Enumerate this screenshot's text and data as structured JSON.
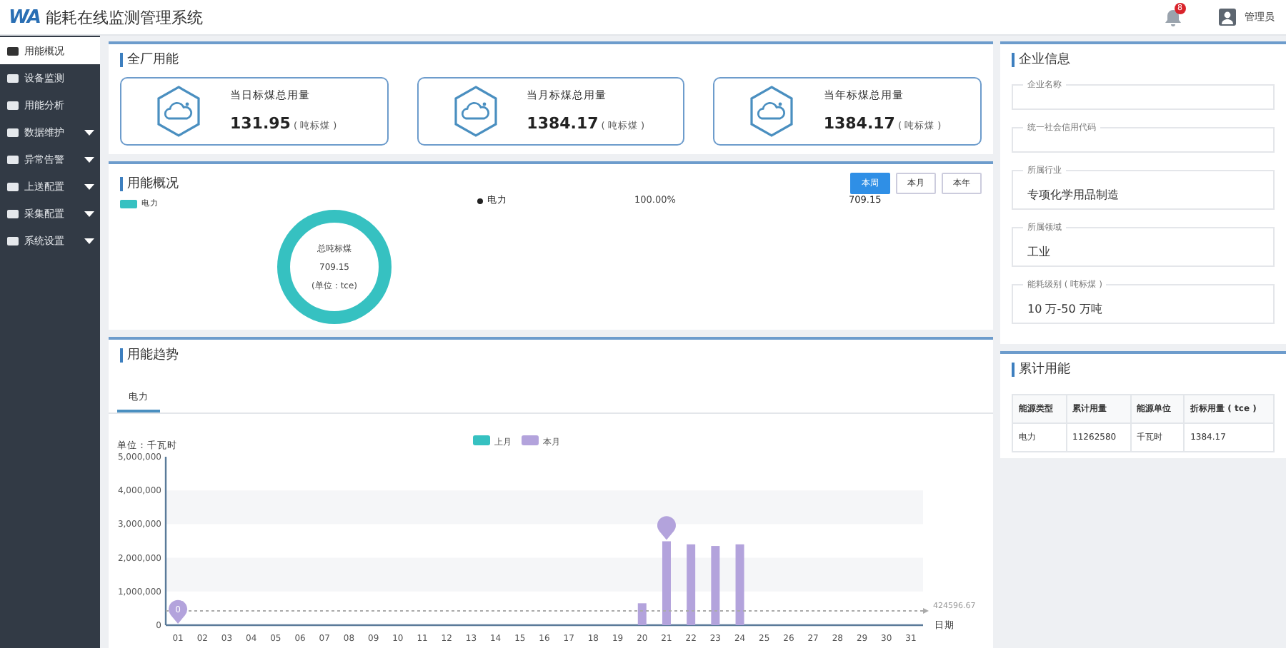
{
  "header": {
    "logo": "WA",
    "title": "能耗在线监测管理系统",
    "notification_count": "8",
    "user": "管理员"
  },
  "sidebar": {
    "items": [
      {
        "label": "用能概况",
        "selected": true,
        "has_submenu": false
      },
      {
        "label": "设备监测",
        "selected": false,
        "has_submenu": false
      },
      {
        "label": "用能分析",
        "selected": false,
        "has_submenu": false
      },
      {
        "label": "数据维护",
        "selected": false,
        "has_submenu": true
      },
      {
        "label": "异常告警",
        "selected": false,
        "has_submenu": true
      },
      {
        "label": "上送配置",
        "selected": false,
        "has_submenu": true
      },
      {
        "label": "采集配置",
        "selected": false,
        "has_submenu": true
      },
      {
        "label": "系统设置",
        "selected": false,
        "has_submenu": true
      }
    ]
  },
  "plant_energy": {
    "title": "全厂用能",
    "cards": [
      {
        "label": "当日标煤总用量",
        "value": "131.95",
        "unit": "( 吨标煤 )"
      },
      {
        "label": "当月标煤总用量",
        "value": "1384.17",
        "unit": "( 吨标煤 )"
      },
      {
        "label": "当年标煤总用量",
        "value": "1384.17",
        "unit": "( 吨标煤 )"
      }
    ]
  },
  "overview": {
    "title": "用能概况",
    "periods": [
      {
        "label": "本周",
        "selected": true
      },
      {
        "label": "本月",
        "selected": false
      },
      {
        "label": "本年",
        "selected": false
      }
    ],
    "legend": [
      {
        "label": "电力",
        "color": "#36c1c1"
      }
    ],
    "donut": {
      "title": "总吨标煤",
      "value": "709.15",
      "unit": "(单位：tce)"
    },
    "rows": [
      {
        "name": "电力",
        "percent": "100.00%",
        "value": "709.15"
      }
    ]
  },
  "trend": {
    "title": "用能趋势",
    "tabs": [
      {
        "label": "电力",
        "selected": true
      }
    ],
    "chart_data": {
      "type": "bar",
      "ylabel": "单位：千瓦时",
      "xlabel": "日期",
      "categories": [
        "01",
        "02",
        "03",
        "04",
        "05",
        "06",
        "07",
        "08",
        "09",
        "10",
        "11",
        "12",
        "13",
        "14",
        "15",
        "16",
        "17",
        "18",
        "19",
        "20",
        "21",
        "22",
        "23",
        "24",
        "25",
        "26",
        "27",
        "28",
        "29",
        "30",
        "31"
      ],
      "series": [
        {
          "name": "上月",
          "color": "#36c1c1",
          "values": [
            null,
            null,
            null,
            null,
            null,
            null,
            null,
            null,
            null,
            null,
            null,
            null,
            null,
            null,
            null,
            null,
            null,
            null,
            null,
            null,
            null,
            null,
            null,
            null,
            null,
            null,
            null,
            null,
            null,
            null,
            null
          ]
        },
        {
          "name": "本月",
          "color": "#b3a3dc",
          "values": [
            0,
            0,
            0,
            0,
            0,
            0,
            0,
            0,
            0,
            0,
            0,
            0,
            0,
            0,
            0,
            0,
            0,
            0,
            0,
            650000,
            2490000,
            2400000,
            2350000,
            2400000,
            null,
            null,
            null,
            null,
            null,
            null,
            null
          ]
        }
      ],
      "ylim": [
        0,
        5000000
      ],
      "yticks": [
        {
          "value": 0,
          "label": "0"
        },
        {
          "value": 1000000,
          "label": "1,000,000"
        },
        {
          "value": 2000000,
          "label": "2,000,000"
        },
        {
          "value": 3000000,
          "label": "3,000,000"
        },
        {
          "value": 4000000,
          "label": "4,000,000"
        },
        {
          "value": 5000000,
          "label": "5,000,000"
        }
      ],
      "annotations": [
        {
          "x": "01",
          "y": 0,
          "text": "0"
        }
      ],
      "ref_lines": [
        {
          "axis": "y",
          "value": 424596.67,
          "label": "424596.67"
        }
      ]
    }
  },
  "company": {
    "title": "企业信息",
    "fields": [
      {
        "label": "企业名称"
      },
      {
        "label": "统一社会信用代码"
      },
      {
        "label": "所属行业",
        "value": "专项化学用品制造"
      },
      {
        "label": "所属领域",
        "value": "工业"
      },
      {
        "label": "能耗级别 ( 吨标煤 )",
        "value": "10 万-50 万吨"
      }
    ]
  },
  "cumulative": {
    "title": "累计用能",
    "columns": [
      "能源类型",
      "累计用量",
      "能源单位",
      "折标用量 ( tce )"
    ],
    "rows": [
      [
        "电力",
        "11262580",
        "千瓦时",
        "1384.17"
      ]
    ]
  }
}
